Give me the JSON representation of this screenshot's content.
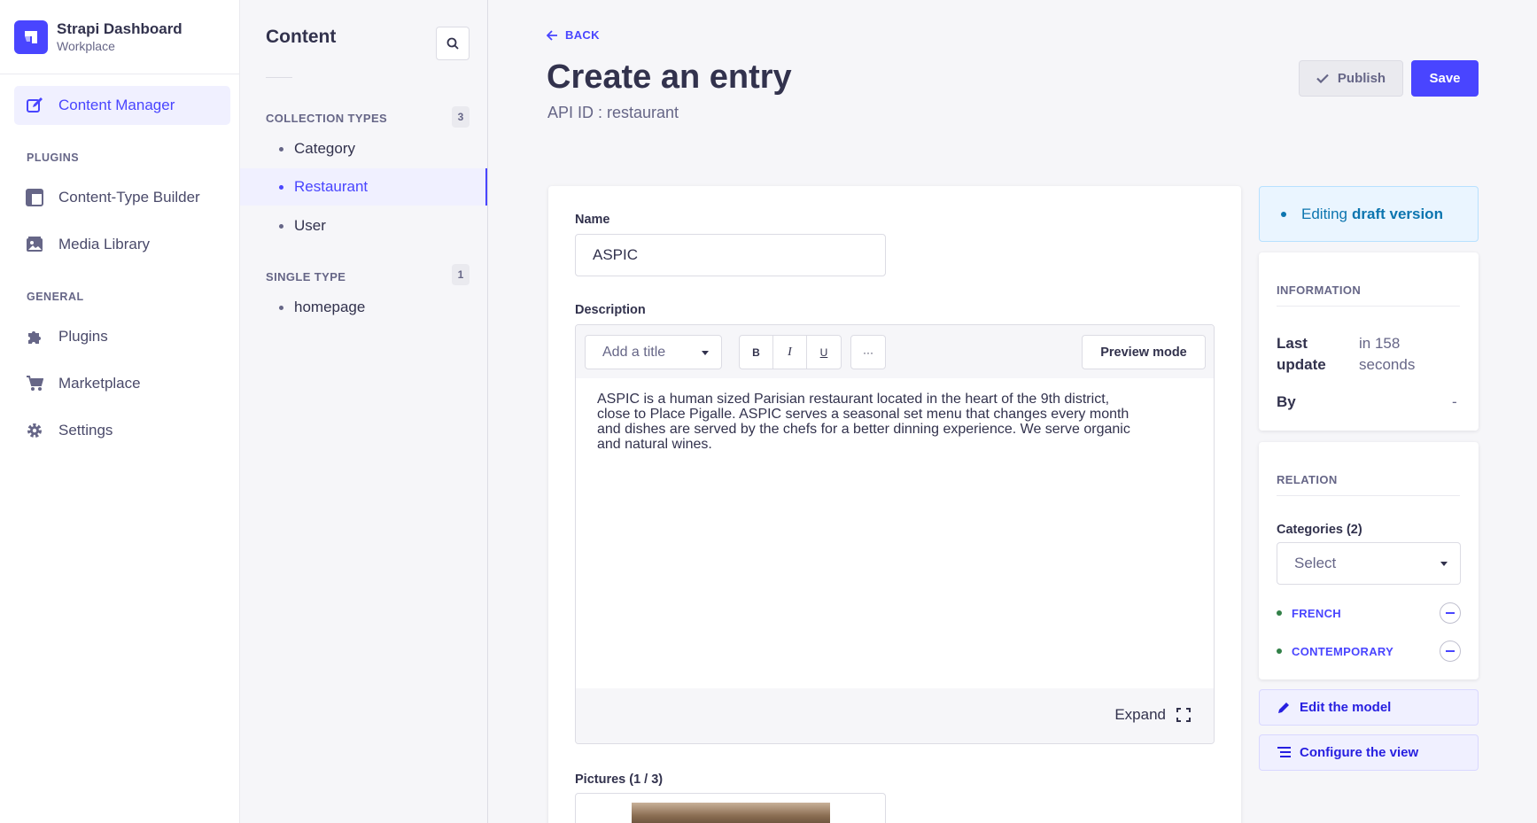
{
  "brand": {
    "title": "Strapi Dashboard",
    "subtitle": "Workplace",
    "logo_icon": "strapi-logo"
  },
  "mainnav": {
    "active_item": "Content Manager",
    "plugins_heading": "PLUGINS",
    "general_heading": "GENERAL",
    "items": [
      {
        "label": "Content Manager",
        "icon": "pen-square-icon"
      },
      {
        "label": "Content-Type Builder",
        "icon": "layout-icon"
      },
      {
        "label": "Media Library",
        "icon": "images-icon"
      },
      {
        "label": "Plugins",
        "icon": "puzzle-icon"
      },
      {
        "label": "Marketplace",
        "icon": "cart-icon"
      },
      {
        "label": "Settings",
        "icon": "gear-icon"
      }
    ]
  },
  "subnav": {
    "title": "Content",
    "collection_heading": "COLLECTION TYPES",
    "collection_count": "3",
    "collection_items": [
      "Category",
      "Restaurant",
      "User"
    ],
    "active_item": "Restaurant",
    "single_heading": "SINGLE TYPE",
    "single_count": "1",
    "single_items": [
      "homepage"
    ]
  },
  "header": {
    "back_label": "BACK",
    "title": "Create an entry",
    "subtitle": "API ID : restaurant",
    "publish_label": "Publish",
    "save_label": "Save"
  },
  "form": {
    "name_label": "Name",
    "name_value": "ASPIC",
    "description_label": "Description",
    "toolbar": {
      "title_select": "Add a title",
      "bold": "B",
      "italic": "I",
      "underline": "U",
      "more": "···",
      "preview_label": "Preview mode"
    },
    "description_lines": [
      "ASPIC is a human sized Parisian restaurant located in the heart of the 9th district,",
      "close to Place Pigalle. ASPIC serves a seasonal set menu that changes every month",
      "and dishes are served by the chefs for a better dinning experience. We serve organic",
      "and natural wines."
    ],
    "expand_label": "Expand",
    "pictures_label": "Pictures (1 / 3)"
  },
  "sidebar": {
    "draft_prefix": "Editing",
    "draft_bold": "draft version",
    "information_heading": "INFORMATION",
    "last_update_key": "Last update",
    "last_update_value": "in 158 seconds",
    "by_key": "By",
    "by_value": "-",
    "relation_heading": "RELATION",
    "categories_label": "Categories (2)",
    "select_placeholder": "Select",
    "relations": [
      "FRENCH",
      "CONTEMPORARY"
    ],
    "edit_model_label": "Edit the model",
    "configure_view_label": "Configure the view"
  },
  "colors": {
    "primary": "#4945ff",
    "draft_blue": "#0c75af",
    "relation_green": "#328048",
    "text_dark": "#32324d",
    "text_muted": "#666687"
  }
}
